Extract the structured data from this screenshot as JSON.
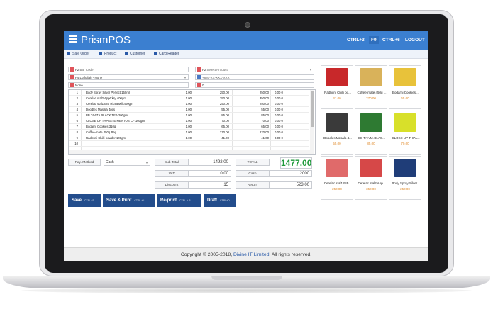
{
  "app": {
    "title": "PrismPOS"
  },
  "topbar": {
    "buttons": [
      "CTRL+3",
      "F9",
      "CTRL+6",
      "LOGOUT"
    ]
  },
  "tabs": [
    "Sale Order",
    "Product",
    "Customer",
    "Card Reader"
  ],
  "inputs": {
    "barcode_key": "F2",
    "barcode_placeholder": "Bar Code",
    "product_key": "F2",
    "product_placeholder": "Select Product",
    "customer_key": "F4",
    "customer_value": "Lutfullah - None",
    "phone_value": "+880-XX-XXX-XXX",
    "name_value": "None",
    "misc_value": "0"
  },
  "table": {
    "rows": [
      {
        "no": "1",
        "name": "Body Spray Silver Perfect 150ml",
        "qty": "1.00",
        "price": "250.00",
        "total": "250.00",
        "disc": "0.00  0"
      },
      {
        "no": "2",
        "name": "Cerelac stal2 AppCkry 400gm",
        "qty": "1.00",
        "price": "350.00",
        "total": "350.00",
        "disc": "0.00  0"
      },
      {
        "no": "3",
        "name": "Cerelac stal1 BIB Rice&Milk400gm",
        "qty": "1.00",
        "price": "250.00",
        "total": "250.00",
        "disc": "0.00  0"
      },
      {
        "no": "4",
        "name": "Doodles Masala 4pcs",
        "qty": "1.00",
        "price": "55.00",
        "total": "55.00",
        "disc": "0.00  0"
      },
      {
        "no": "5",
        "name": "BB TAAZA BLACK TEA 200gm",
        "qty": "1.00",
        "price": "85.00",
        "total": "85.00",
        "disc": "0.00  0"
      },
      {
        "no": "6",
        "name": "CLOSE UP THPASTE MENTOS CF 160gm",
        "qty": "1.00",
        "price": "70.00",
        "total": "70.00",
        "disc": "0.00  0"
      },
      {
        "no": "7",
        "name": "Bodarni Cookies 310g",
        "qty": "1.00",
        "price": "65.00",
        "total": "65.00",
        "disc": "0.00  0"
      },
      {
        "no": "8",
        "name": "Coffee-mate 450g Bag",
        "qty": "1.00",
        "price": "270.00",
        "total": "270.00",
        "disc": "0.00  0"
      },
      {
        "no": "9",
        "name": "Radhuni Chilli powder 100gm",
        "qty": "1.00",
        "price": "41.00",
        "total": "41.00",
        "disc": "0.00  0"
      },
      {
        "no": "10",
        "name": "",
        "qty": "",
        "price": "",
        "total": "",
        "disc": ""
      }
    ]
  },
  "payment": {
    "label": "Pay. Method",
    "method": "Cash"
  },
  "summary": {
    "subtotal_label": "Sub Total",
    "subtotal": "1492.00",
    "total_label": "TOTAL",
    "total": "1477.00",
    "vat_label": "VAT",
    "vat": "0.00",
    "cash_label": "Cash",
    "cash": "2000",
    "discount_label": "Discount",
    "discount": "15",
    "return_label": "Return",
    "return": "523.00"
  },
  "actions": [
    {
      "label": "Save",
      "key": "CTRL+S"
    },
    {
      "label": "Save & Print",
      "key": "CTRL + I"
    },
    {
      "label": "Re-print",
      "key": "CTRL + R"
    },
    {
      "label": "Draft",
      "key": "CTRL+D"
    }
  ],
  "products": [
    {
      "name": "Radhuni Chilli po...",
      "price": "41.00",
      "color": "#c8282a"
    },
    {
      "name": "Coffee-mate 450g ...",
      "price": "270.00",
      "color": "#d9b25a"
    },
    {
      "name": "Bodarni Cookies ...",
      "price": "65.00",
      "color": "#e8c23a"
    },
    {
      "name": "Doodles Masala 4...",
      "price": "55.00",
      "color": "#3a3a3a"
    },
    {
      "name": "BB TAAZA BLAC...",
      "price": "85.00",
      "color": "#2e7a32"
    },
    {
      "name": "CLOSE UP THPA...",
      "price": "70.00",
      "color": "#d8e02a"
    },
    {
      "name": "Cerelac stal1 BIB...",
      "price": "250.00",
      "color": "#e06a6a"
    },
    {
      "name": "Cerelac stal2 App...",
      "price": "350.00",
      "color": "#d64848"
    },
    {
      "name": "Body Spray Silver...",
      "price": "250.00",
      "color": "#1f3d78"
    }
  ],
  "footer": {
    "prefix": "Copyright © 2005-2018, ",
    "link": "Divine IT Limited",
    "suffix": ". All rights reserved."
  }
}
